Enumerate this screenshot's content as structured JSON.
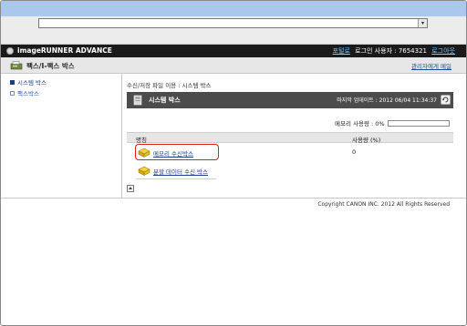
{
  "app": {
    "brand": "imageRUNNER ADVANCE",
    "portal_link": "포털로",
    "user_text": "로그인 사용자 : 7654321",
    "logout_link": "로그아웃"
  },
  "header": {
    "title": "팩스/I-팩스 박스",
    "admin_link": "관리자에게 메일"
  },
  "sidebar": {
    "items": [
      {
        "label": "시스템 박스",
        "active": true
      },
      {
        "label": "팩스박스",
        "active": false
      }
    ]
  },
  "main": {
    "breadcrumb": "수신/저장 파일 이용 : 시스템 박스",
    "panel_title": "시스템 박스",
    "last_update": "마지막 업데이트 : 2012 06/04 11:34:37",
    "memory_label": "메모리 사용량 : 0%",
    "memory_usage_fraction": 0,
    "table": {
      "headers": [
        "명칭",
        "사용량 (%)"
      ],
      "rows": [
        {
          "name": "메모리 수신박스",
          "usage": "0",
          "highlighted": true
        },
        {
          "name": "분할 데이터 수신 박스",
          "usage": "",
          "highlighted": false
        }
      ]
    }
  },
  "footer": {
    "copyright": "Copyright CANON INC. 2012 All Rights Reserved"
  },
  "icons": {
    "brand": "canon-logo-icon",
    "header": "fax-machine-icon",
    "panel": "system-box-icon",
    "refresh": "refresh-icon",
    "box": "box-folder-icon",
    "top": "back-to-top-icon"
  },
  "colors": {
    "titlebar": "#a9c8ec",
    "appbar": "#1a1a1a",
    "link": "#1f3f82",
    "highlight": "#e02020"
  }
}
